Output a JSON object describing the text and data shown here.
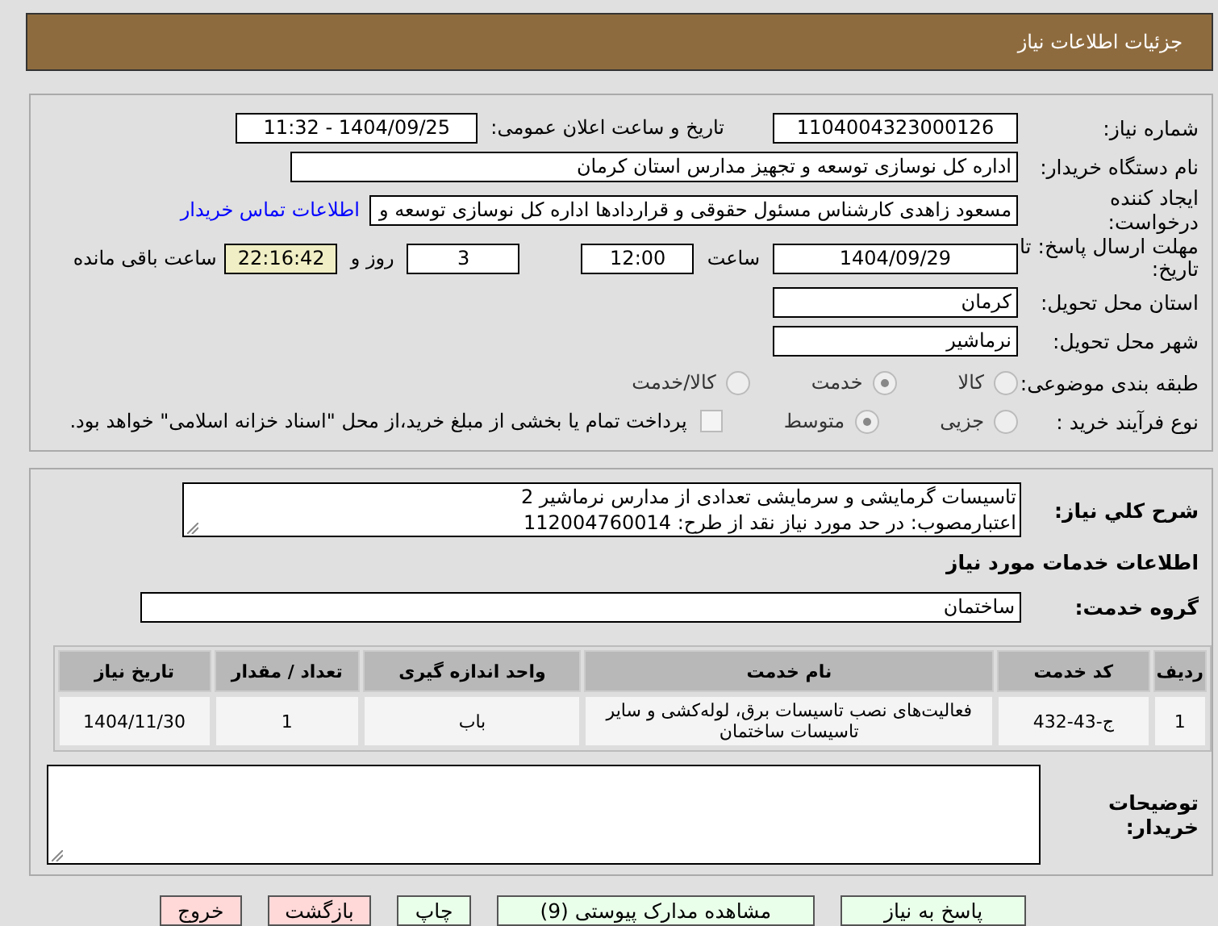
{
  "header": {
    "title": "جزئیات اطلاعات نیاز"
  },
  "need_number": {
    "label": "شماره نیاز:",
    "value": "1104004323000126"
  },
  "announce": {
    "label": "تاریخ و ساعت اعلان عمومی:",
    "value": "1404/09/25 - 11:32"
  },
  "buyer_org": {
    "label": "نام دستگاه خریدار:",
    "value": "اداره کل نوسازی  توسعه و تجهیز مدارس استان کرمان"
  },
  "requester": {
    "label": "ایجاد کننده درخواست:",
    "value": "مسعود زاهدی کارشناس مسئول حقوقی و قراردادها اداره کل نوسازی  توسعه و",
    "link": "اطلاعات تماس خریدار"
  },
  "deadline": {
    "label": "مهلت ارسال پاسخ: تا تاریخ:",
    "date": "1404/09/29",
    "time_label": "ساعت",
    "time": "12:00",
    "days": "3",
    "days_label": "روز و",
    "remaining": "22:16:42",
    "remaining_label": "ساعت باقی مانده"
  },
  "province": {
    "label": "استان محل تحویل:",
    "value": "کرمان"
  },
  "city": {
    "label": "شهر محل تحویل:",
    "value": "نرماشیر"
  },
  "category": {
    "label": "طبقه بندی موضوعی:",
    "options": [
      {
        "label": "کالا",
        "selected": false
      },
      {
        "label": "خدمت",
        "selected": true
      },
      {
        "label": "کالا/خدمت",
        "selected": false
      }
    ]
  },
  "purchase_type": {
    "label": "نوع فرآیند خرید :",
    "options": [
      {
        "label": "جزیی",
        "selected": false
      },
      {
        "label": "متوسط",
        "selected": true
      }
    ],
    "payment": {
      "checked": false,
      "text": "پرداخت تمام یا بخشی از مبلغ خرید،از محل \"اسناد خزانه اسلامی\" خواهد بود."
    }
  },
  "description": {
    "label": "شرح کلي نياز:",
    "lines": [
      "تاسیسات گرمایشی و سرمایشی تعدادی از مدارس نرماشیر 2",
      "اعتبارمصوب: در حد مورد نیاز نقد  از طرح: 112004760014"
    ]
  },
  "services_heading": "اطلاعات خدمات مورد نیاز",
  "service_group": {
    "label": "گروه خدمت:",
    "value": "ساختمان"
  },
  "table": {
    "columns": [
      "ردیف",
      "کد خدمت",
      "نام خدمت",
      "واحد اندازه گیری",
      "تعداد / مقدار",
      "تاریخ نیاز"
    ],
    "rows": [
      [
        "1",
        "ج-43-432",
        "فعالیت‌های نصب تاسیسات برق، لوله‌کشی و سایر تاسیسات ساختمان",
        "باب",
        "1",
        "1404/11/30"
      ]
    ]
  },
  "buyer_notes": {
    "label": "توضیحات خریدار:"
  },
  "buttons": [
    {
      "label": "پاسخ به نیاز",
      "kind": "primary"
    },
    {
      "label": "مشاهده مدارک پیوستی (9)",
      "kind": "primary"
    },
    {
      "label": "چاپ",
      "kind": "primary"
    },
    {
      "label": "بازگشت",
      "kind": "danger"
    },
    {
      "label": "خروج",
      "kind": "danger"
    }
  ]
}
